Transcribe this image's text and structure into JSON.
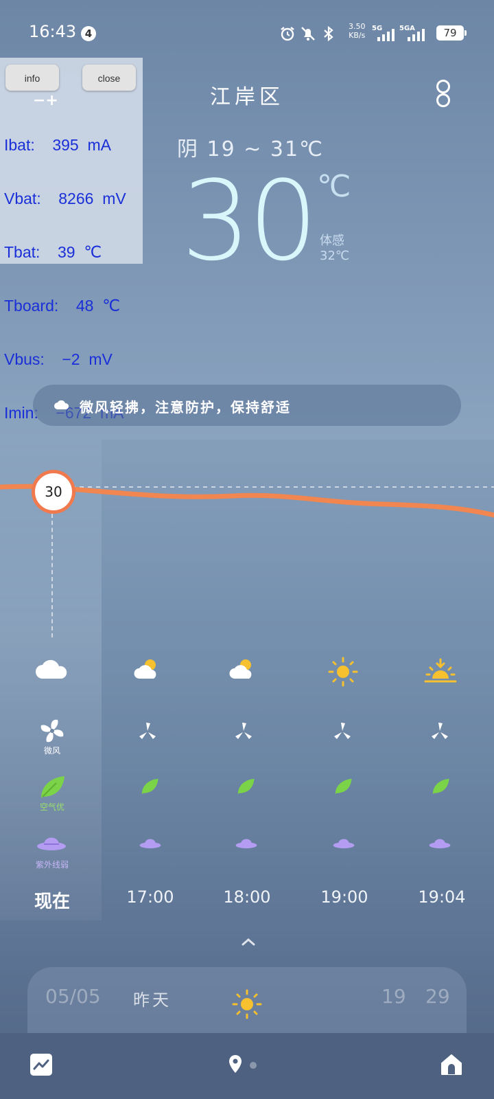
{
  "status_bar": {
    "time": "16:43",
    "notification_count": "4",
    "net_speed_value": "3.50",
    "net_speed_unit": "KB/s",
    "sim1_label": "5G",
    "sim2_label": "5GA",
    "battery": "79"
  },
  "debug_overlay": {
    "info_label": "info",
    "close_label": "close",
    "lines": [
      "Ibat:    395  mA",
      "Vbat:    8266  mV",
      "Tbat:    39  ℃",
      "Tboard:    48  ℃",
      "Vbus:    −2  mV",
      "Imin:    −672  mA"
    ]
  },
  "header": {
    "city": "江岸区",
    "condition_range": "阴  19 ~ 31℃",
    "current_temp": "30",
    "temp_unit": "℃",
    "feels_like_label": "体感",
    "feels_like_value": "32℃"
  },
  "tip": {
    "text": "微风轻拂，注意防护，保持舒适"
  },
  "hourly": {
    "now_temp": "30",
    "wind_label": "微风",
    "air_label": "空气优",
    "uv_label": "紫外线弱",
    "columns": [
      {
        "time": "现在",
        "icon": "cloudy-icon"
      },
      {
        "time": "17:00",
        "icon": "partly-cloudy-icon"
      },
      {
        "time": "18:00",
        "icon": "partly-cloudy-icon"
      },
      {
        "time": "19:00",
        "icon": "sun-icon"
      },
      {
        "time": "19:04",
        "icon": "sunset-icon"
      }
    ]
  },
  "daily": {
    "date": "05/05",
    "day": "昨天",
    "icon": "sun-icon",
    "low": "19",
    "high": "29"
  },
  "colors": {
    "temp_line": "#f28650",
    "leaf": "#7bd348",
    "uv_hat": "#b39cf2",
    "sun": "#f6c02e"
  }
}
